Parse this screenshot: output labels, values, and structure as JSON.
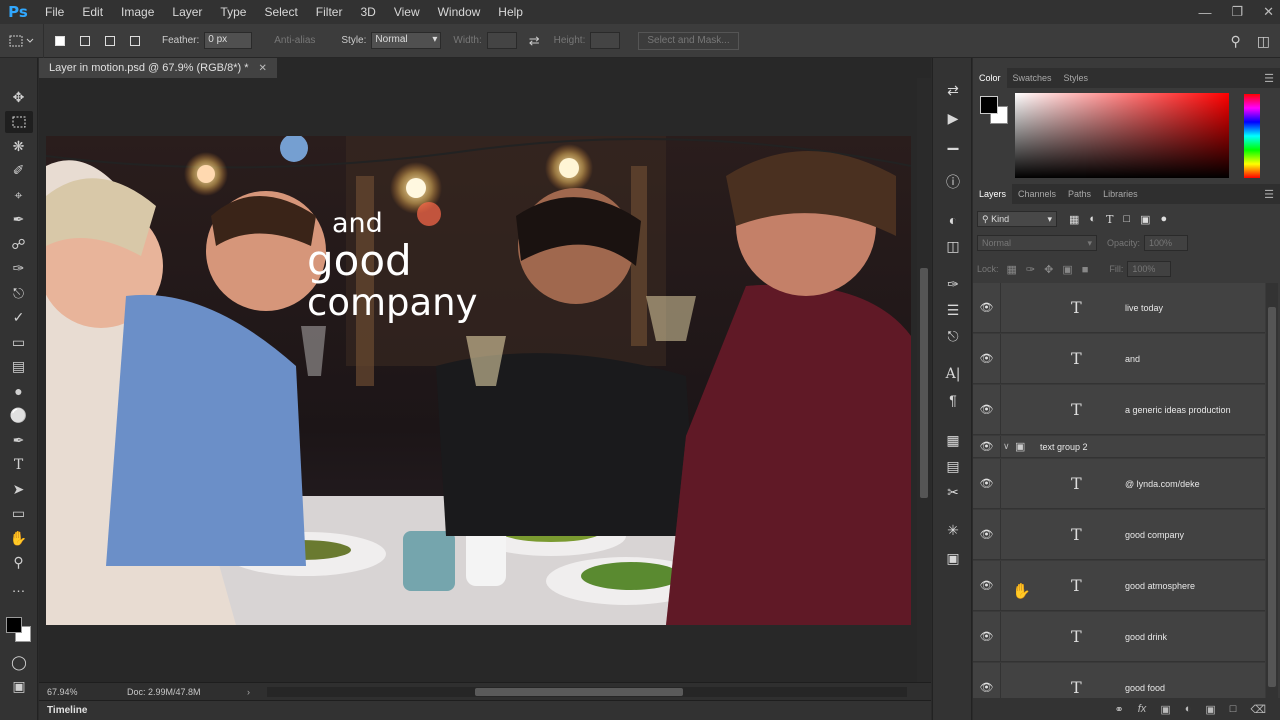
{
  "app": {
    "logo": "Ps",
    "menu": [
      "File",
      "Edit",
      "Image",
      "Layer",
      "Type",
      "Select",
      "Filter",
      "3D",
      "View",
      "Window",
      "Help"
    ],
    "window_controls": [
      "minimize-icon",
      "restore-icon",
      "close-icon"
    ]
  },
  "options": {
    "feather_label": "Feather:",
    "feather_value": "0 px",
    "antialias_label": "Anti-alias",
    "style_label": "Style:",
    "style_value": "Normal",
    "width_label": "Width:",
    "height_label": "Height:",
    "select_mask_label": "Select and Mask..."
  },
  "tools": [
    "move-icon",
    "marquee-icon",
    "lasso-icon",
    "quick-select-icon",
    "crop-icon",
    "eyedropper-icon",
    "healing-icon",
    "brush-icon",
    "stamp-icon",
    "history-brush-icon",
    "eraser-icon",
    "gradient-icon",
    "blur-icon",
    "dodge-icon",
    "pen-icon",
    "type-icon",
    "path-select-icon",
    "rectangle-icon",
    "hand-icon",
    "zoom-icon",
    "more-tools-icon"
  ],
  "document": {
    "tab_title": "Layer in motion.psd @ 67.9% (RGB/8*) *",
    "overlay_text": [
      "and",
      "good",
      "company"
    ]
  },
  "status": {
    "zoom": "67.94%",
    "doc_size": "Doc: 2.99M/47.8M"
  },
  "timeline": {
    "label": "Timeline"
  },
  "color_panel": {
    "tabs": [
      "Color",
      "Swatches",
      "Styles"
    ],
    "active_tab": "Color",
    "foreground": "#000000",
    "background": "#ffffff"
  },
  "layers_panel": {
    "tabs": [
      "Layers",
      "Channels",
      "Paths",
      "Libraries"
    ],
    "filter_kind": "Kind",
    "blend_mode": "Normal",
    "opacity_label": "Opacity:",
    "opacity_value": "100%",
    "lock_label": "Lock:",
    "fill_label": "Fill:",
    "fill_value": "100%",
    "layers": [
      {
        "name": "live today",
        "type": "text"
      },
      {
        "name": "and",
        "type": "text"
      },
      {
        "name": "a generic ideas production",
        "type": "text"
      },
      {
        "name": "text group 2",
        "type": "group"
      },
      {
        "name": "@ lynda.com/deke",
        "type": "text"
      },
      {
        "name": "good company",
        "type": "text"
      },
      {
        "name": "good atmosphere",
        "type": "text"
      },
      {
        "name": "good drink",
        "type": "text"
      },
      {
        "name": "good food",
        "type": "text"
      }
    ]
  }
}
